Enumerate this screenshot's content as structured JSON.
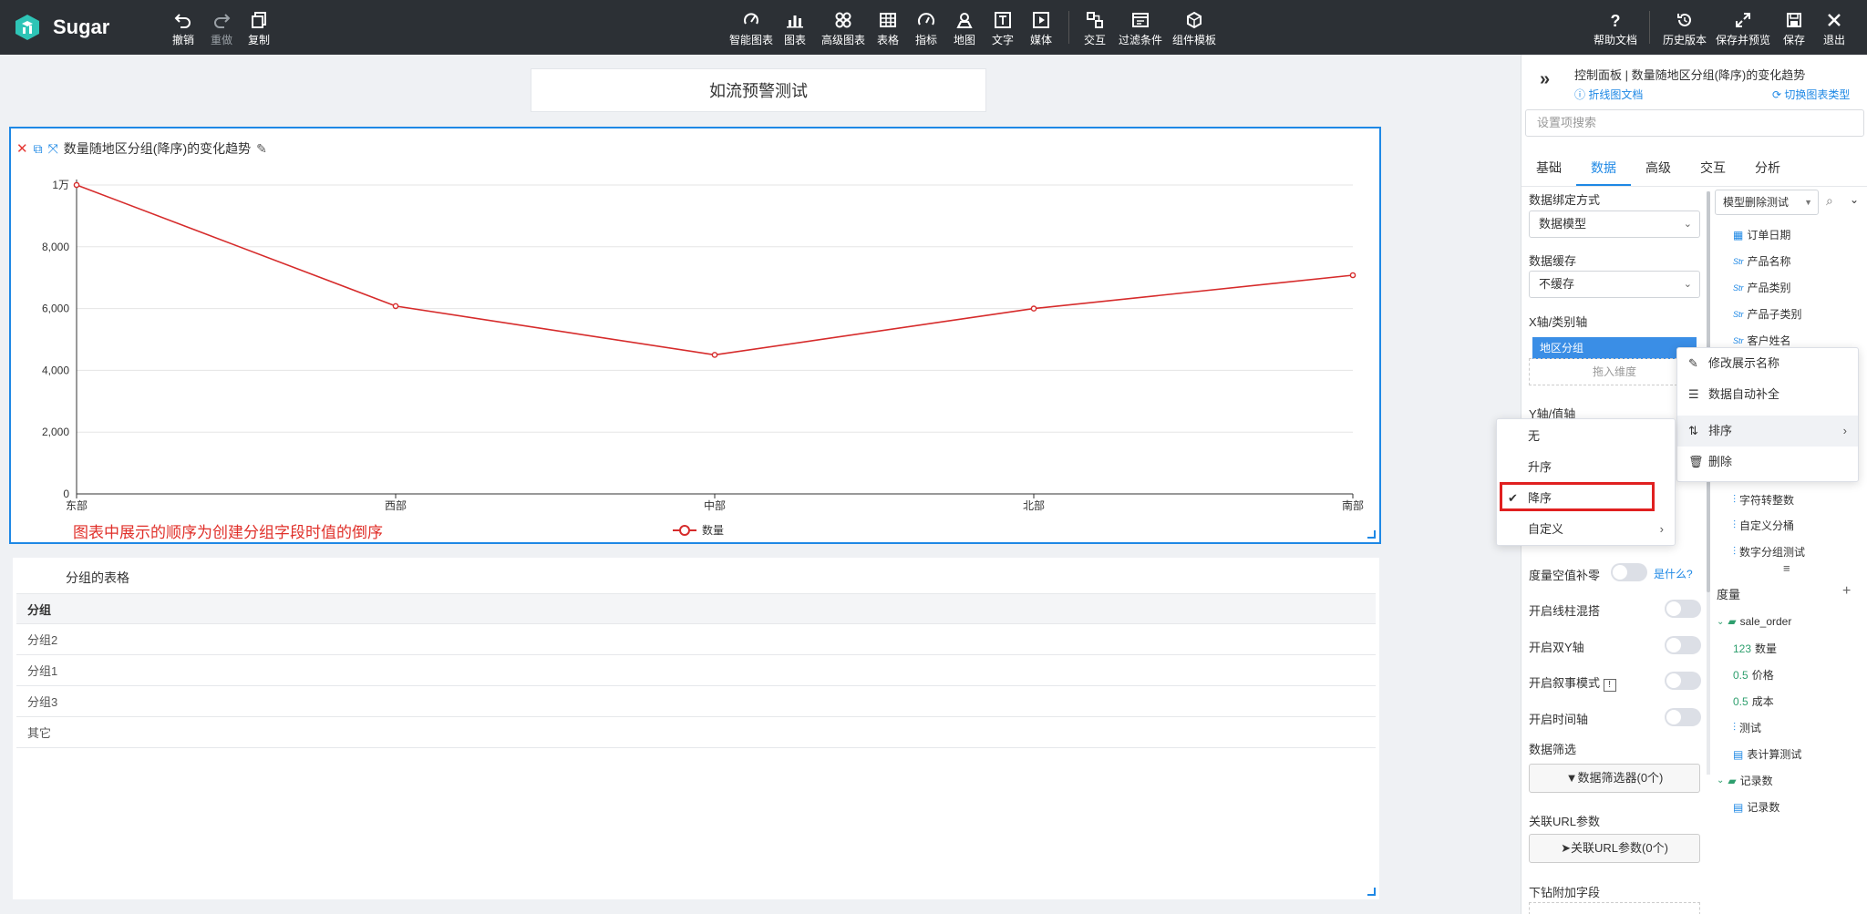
{
  "app": {
    "name": "Sugar"
  },
  "toolbar": {
    "left": [
      {
        "label": "撤销",
        "icon": "undo-icon"
      },
      {
        "label": "重做",
        "icon": "redo-icon"
      },
      {
        "label": "复制",
        "icon": "copy-icon"
      }
    ],
    "center": [
      {
        "label": "智能图表"
      },
      {
        "label": "图表"
      },
      {
        "label": "高级图表"
      },
      {
        "label": "表格"
      },
      {
        "label": "指标"
      },
      {
        "label": "地图"
      },
      {
        "label": "文字"
      },
      {
        "label": "媒体"
      },
      {
        "label": "交互"
      },
      {
        "label": "过滤条件"
      },
      {
        "label": "组件模板"
      }
    ],
    "right": [
      {
        "label": "帮助文档"
      },
      {
        "label": "历史版本"
      },
      {
        "label": "保存并预览"
      },
      {
        "label": "保存"
      },
      {
        "label": "退出"
      }
    ]
  },
  "page": {
    "title": "如流预警测试"
  },
  "chart_card": {
    "title": "数量随地区分组(降序)的变化趋势",
    "annotation": "图表中展示的顺序为创建分组字段时值的倒序",
    "legend": "数量"
  },
  "chart_data": {
    "type": "line",
    "categories": [
      "东部",
      "西部",
      "中部",
      "北部",
      "南部"
    ],
    "series": [
      {
        "name": "数量",
        "values": [
          10000,
          6080,
          4500,
          6000,
          7080
        ],
        "color": "#d62b2b"
      }
    ],
    "yticks": [
      "0",
      "2,000",
      "4,000",
      "6,000",
      "8,000",
      "1万"
    ],
    "ylim": [
      0,
      10000
    ],
    "grid": true,
    "legend_position": "bottom"
  },
  "table_card": {
    "title": "分组的表格",
    "header": "分组",
    "rows": [
      "分组2",
      "分组1",
      "分组3",
      "其它"
    ]
  },
  "panel": {
    "title": "控制面板 | 数量随地区分组(降序)的变化趋势",
    "doc_link": "折线图文档",
    "switch_link": "切换图表类型",
    "search_placeholder": "设置项搜索",
    "tabs": [
      "基础",
      "数据",
      "高级",
      "交互",
      "分析"
    ],
    "active_tab": "数据",
    "binding_label": "数据绑定方式",
    "binding_value": "数据模型",
    "cache_label": "数据缓存",
    "cache_value": "不缓存",
    "x_axis_label": "X轴/类别轴",
    "x_axis_field": "地区分组",
    "drop_hint": "拖入维度",
    "y_axis_label": "Y轴/值轴",
    "null_fill_label": "度量空值补零",
    "what_link": "是什么?",
    "combo_label": "开启线柱混搭",
    "dual_y_label": "开启双Y轴",
    "narrative_label": "开启叙事模式",
    "time_axis_label": "开启时间轴",
    "filter_label": "数据筛选",
    "filter_button": "数据筛选器(0个)",
    "url_label": "关联URL参数",
    "url_button": "关联URL参数(0个)",
    "drill_label": "下钻附加字段"
  },
  "fields": {
    "model": "模型删除测试",
    "dimensions": [
      {
        "type": "date",
        "name": "订单日期"
      },
      {
        "type": "Str",
        "name": "产品名称"
      },
      {
        "type": "Str",
        "name": "产品类别"
      },
      {
        "type": "Str",
        "name": "产品子类别"
      },
      {
        "type": "Str",
        "name": "客户姓名"
      }
    ],
    "dimensions_lower": [
      "字符转整数",
      "自定义分桶",
      "数字分组测试"
    ],
    "measure_header": "度量",
    "folder1": "sale_order",
    "measures": [
      {
        "type": "123",
        "name": "数量"
      },
      {
        "type": "0.5",
        "name": "价格"
      },
      {
        "type": "0.5",
        "name": "成本"
      },
      {
        "type": "calc",
        "name": "测试"
      },
      {
        "type": "table",
        "name": "表计算测试"
      }
    ],
    "folder2": "记录数",
    "records": "记录数"
  },
  "context_menu": {
    "items": [
      "修改展示名称",
      "数据自动补全",
      "排序",
      "删除"
    ]
  },
  "sort_menu": {
    "items": [
      "无",
      "升序",
      "降序",
      "自定义"
    ],
    "selected": "降序"
  }
}
